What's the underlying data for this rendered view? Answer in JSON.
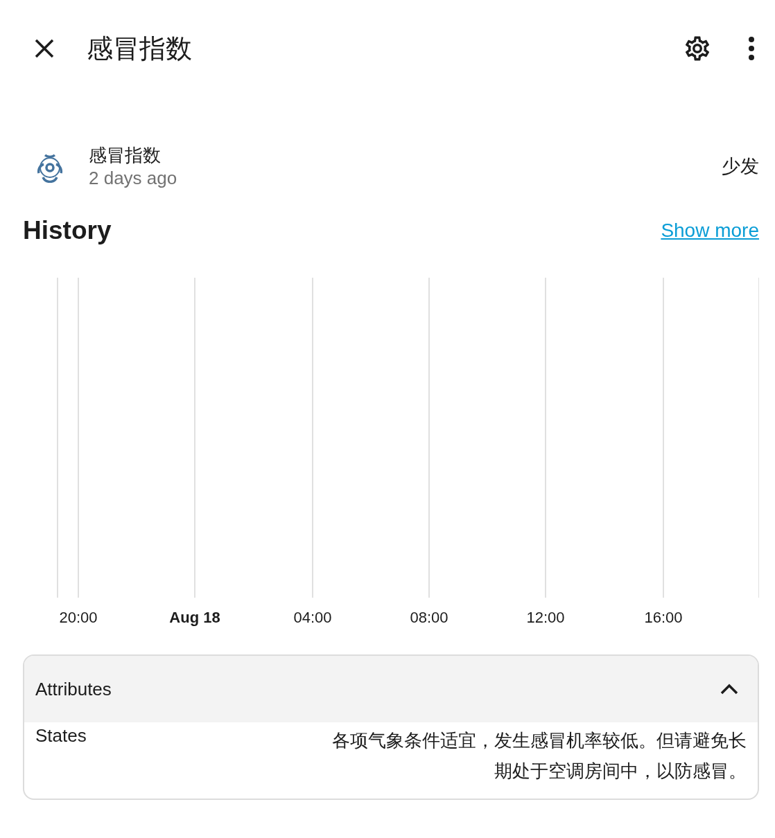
{
  "dialog": {
    "title": "感冒指数"
  },
  "entity": {
    "name": "感冒指数",
    "last_changed": "2 days ago",
    "state": "少发"
  },
  "history": {
    "title": "History",
    "show_more": "Show more",
    "ticks": [
      {
        "label": "20:00",
        "kind": "time"
      },
      {
        "label": "Aug 18",
        "kind": "date"
      },
      {
        "label": "04:00",
        "kind": "time"
      },
      {
        "label": "08:00",
        "kind": "time"
      },
      {
        "label": "12:00",
        "kind": "time"
      },
      {
        "label": "16:00",
        "kind": "time"
      }
    ]
  },
  "attributes": {
    "title": "Attributes",
    "expanded": true,
    "rows": [
      {
        "name": "States",
        "value": "各项气象条件适宜，发生感冒机率较低。但请避免长期处于空调房间中，以防感冒。"
      }
    ]
  }
}
